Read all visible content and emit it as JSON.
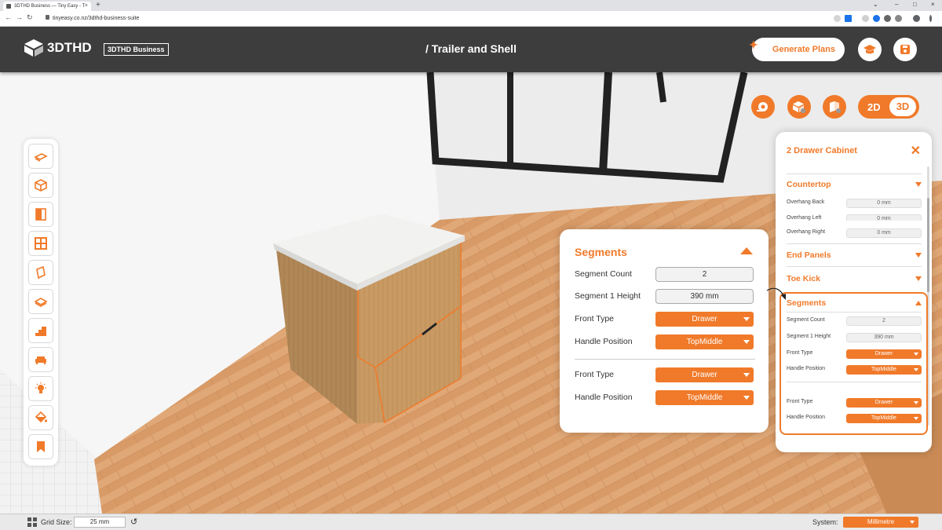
{
  "browser": {
    "tab_title": "3DTHD Business — Tiny Easy - T",
    "url": "tinyeasy.co.nz/3dthd-business-suite"
  },
  "header": {
    "logo_text": "3DTHD",
    "badge": "3DTHD Business",
    "breadcrumb": "/ Trailer and Shell",
    "generate_label": "Generate Plans"
  },
  "view_toggle": {
    "label_2d": "2D",
    "label_3d": "3D",
    "active": "3D"
  },
  "segments_panel": {
    "title": "Segments",
    "segment_count_label": "Segment Count",
    "segment_count": "2",
    "segment1_height_label": "Segment 1 Height",
    "segment1_height": "390 mm",
    "seg1": {
      "front_type_label": "Front Type",
      "front_type": "Drawer",
      "handle_label": "Handle Position",
      "handle": "TopMiddle"
    },
    "seg2": {
      "front_type_label": "Front Type",
      "front_type": "Drawer",
      "handle_label": "Handle Position",
      "handle": "TopMiddle"
    }
  },
  "props_panel": {
    "title": "2 Drawer Cabinet",
    "countertop": {
      "heading": "Countertop",
      "overhang_back_label": "Overhang Back",
      "overhang_back": "0 mm",
      "overhang_left_label": "Overhang Left",
      "overhang_left": "0 mm",
      "overhang_right_label": "Overhang Right",
      "overhang_right": "0 mm"
    },
    "end_panels": "End Panels",
    "toe_kick": "Toe Kick",
    "segments": {
      "heading": "Segments",
      "count_label": "Segment Count",
      "count": "2",
      "height_label": "Segment 1 Height",
      "height": "390 mm",
      "s1_front_label": "Front Type",
      "s1_front": "Drawer",
      "s1_handle_label": "Handle Position",
      "s1_handle": "TopMiddle",
      "s2_front_label": "Front Type",
      "s2_front": "Drawer",
      "s2_handle_label": "Handle Position",
      "s2_handle": "TopMiddle"
    }
  },
  "statusbar": {
    "grid_label": "Grid Size:",
    "grid_value": "25 mm",
    "system_label": "System:",
    "system_value": "Millimetre"
  },
  "colors": {
    "accent": "#f07a2a",
    "header_bg": "#3d3d3d"
  }
}
